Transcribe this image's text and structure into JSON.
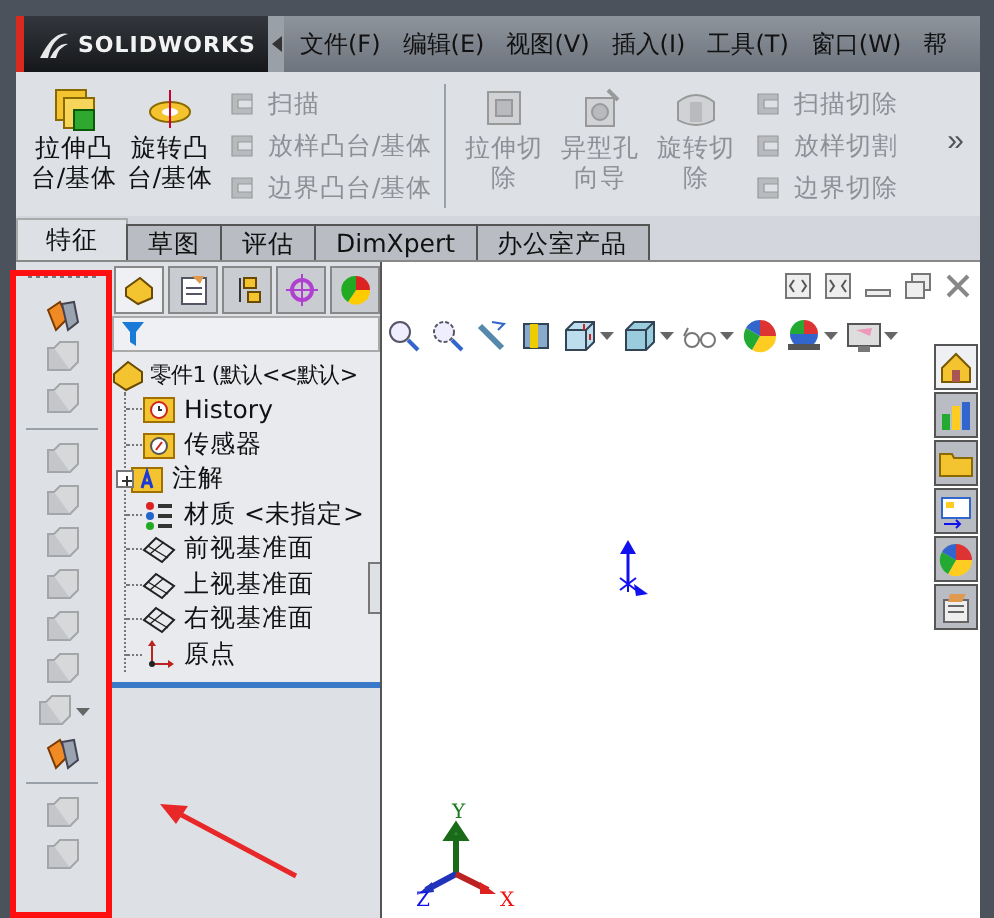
{
  "app": {
    "brand": "SOLIDWORKS"
  },
  "menu": [
    "文件(F)",
    "编辑(E)",
    "视图(V)",
    "插入(I)",
    "工具(T)",
    "窗口(W)",
    "帮"
  ],
  "command_manager": {
    "groups": [
      {
        "large": [
          {
            "label": "拉伸凸台/基体",
            "kind": "extrude",
            "disabled": false
          },
          {
            "label": "旋转凸台/基体",
            "kind": "revolve",
            "disabled": false
          }
        ],
        "small": [
          {
            "label": "扫描",
            "disabled": true
          },
          {
            "label": "放样凸台/基体",
            "disabled": true
          },
          {
            "label": "边界凸台/基体",
            "disabled": true
          }
        ]
      },
      {
        "large": [
          {
            "label": "拉伸切除",
            "kind": "cut",
            "disabled": true
          },
          {
            "label": "异型孔向导",
            "kind": "hole",
            "disabled": true
          },
          {
            "label": "旋转切除",
            "kind": "revcut",
            "disabled": true
          }
        ],
        "small": [
          {
            "label": "扫描切除",
            "disabled": true
          },
          {
            "label": "放样切割",
            "disabled": true
          },
          {
            "label": "边界切除",
            "disabled": true
          }
        ]
      }
    ],
    "overflow": "»"
  },
  "tabs": [
    {
      "label": "特征",
      "selected": true
    },
    {
      "label": "草图",
      "selected": false
    },
    {
      "label": "评估",
      "selected": false
    },
    {
      "label": "DimXpert",
      "selected": false
    },
    {
      "label": "办公室产品",
      "selected": false
    }
  ],
  "feature_toolbar": [
    {
      "kind": "tool",
      "disabled": false
    },
    {
      "kind": "tool",
      "disabled": true
    },
    {
      "kind": "tool",
      "disabled": true
    },
    {
      "kind": "separator"
    },
    {
      "kind": "tool",
      "disabled": true
    },
    {
      "kind": "tool",
      "disabled": true
    },
    {
      "kind": "tool",
      "disabled": true
    },
    {
      "kind": "tool",
      "disabled": true
    },
    {
      "kind": "tool",
      "disabled": true
    },
    {
      "kind": "tool",
      "disabled": true
    },
    {
      "kind": "dropdown",
      "disabled": true
    },
    {
      "kind": "tool",
      "disabled": false
    },
    {
      "kind": "separator"
    },
    {
      "kind": "tool",
      "disabled": true
    },
    {
      "kind": "tool",
      "disabled": true
    }
  ],
  "feature_manager": {
    "tabs": [
      {
        "kind": "tree",
        "selected": true
      },
      {
        "kind": "property",
        "selected": false
      },
      {
        "kind": "config",
        "selected": false
      },
      {
        "kind": "dimxpert",
        "selected": false
      },
      {
        "kind": "display",
        "selected": false
      }
    ],
    "tree": {
      "label": "零件1  (默认<<默认>",
      "kind": "part",
      "children": [
        {
          "label": "History",
          "kind": "history"
        },
        {
          "label": "传感器",
          "kind": "sensors"
        },
        {
          "label": "注解",
          "kind": "annotations",
          "expanded": false
        },
        {
          "label": "材质 <未指定>",
          "kind": "material"
        },
        {
          "label": "前视基准面",
          "kind": "plane"
        },
        {
          "label": "上视基准面",
          "kind": "plane"
        },
        {
          "label": "右视基准面",
          "kind": "plane"
        },
        {
          "label": "原点",
          "kind": "origin"
        }
      ]
    }
  },
  "graphics": {
    "triad_labels": [
      "Y",
      "Z",
      "X"
    ]
  },
  "task_pane": [
    {
      "selected": true
    },
    {
      "selected": false
    },
    {
      "selected": false
    },
    {
      "selected": false
    },
    {
      "selected": false
    },
    {
      "selected": false
    }
  ],
  "annotations": [
    {
      "kind": "frame",
      "color": "#ff1010"
    },
    {
      "kind": "arrow",
      "color": "#e82828"
    }
  ]
}
